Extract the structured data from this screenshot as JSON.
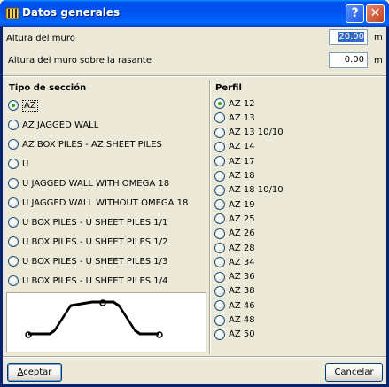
{
  "window": {
    "title": "Datos generales"
  },
  "titlebar": {
    "help_label": "?",
    "close_label": "✕"
  },
  "fields": {
    "altura_label": "Altura del muro",
    "altura_value": "20.00",
    "altura_unit": "m",
    "rasante_label": "Altura del muro sobre la rasante",
    "rasante_value": "0.00",
    "rasante_unit": "m"
  },
  "tipo": {
    "title": "Tipo de sección",
    "selected": 0,
    "options": [
      "AZ",
      "AZ JAGGED WALL",
      "AZ BOX PILES - AZ SHEET PILES",
      "U",
      "U JAGGED WALL WITH OMEGA 18",
      "U JAGGED WALL WITHOUT OMEGA 18",
      "U BOX PILES - U SHEET PILES 1/1",
      "U BOX PILES - U SHEET PILES 1/2",
      "U BOX PILES - U SHEET PILES 1/3",
      "U BOX PILES - U SHEET PILES 1/4"
    ]
  },
  "perfil": {
    "title": "Perfil",
    "selected": 0,
    "options": [
      "AZ 12",
      "AZ 13",
      "AZ 13 10/10",
      "AZ 14",
      "AZ 17",
      "AZ 18",
      "AZ 18 10/10",
      "AZ 19",
      "AZ 25",
      "AZ 26",
      "AZ 28",
      "AZ 34",
      "AZ 36",
      "AZ 38",
      "AZ 46",
      "AZ 48",
      "AZ 50"
    ]
  },
  "buttons": {
    "accept_first": "A",
    "accept_rest": "ceptar",
    "cancel": "Cancelar"
  }
}
